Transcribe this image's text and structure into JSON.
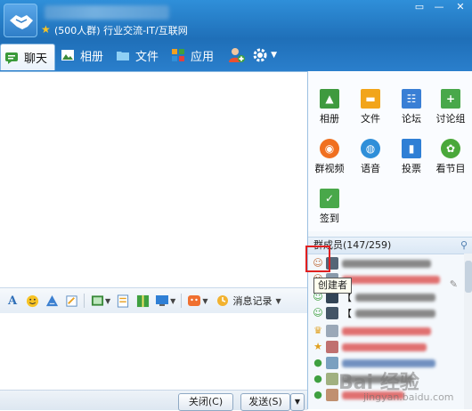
{
  "header": {
    "group_info": "(500人群) 行业交流-IT/互联网",
    "window_controls": [
      "▭",
      "—",
      "✕"
    ]
  },
  "tabs": [
    {
      "label": "聊天",
      "icon": "chat-icon",
      "active": true
    },
    {
      "label": "相册",
      "icon": "album-icon",
      "active": false
    },
    {
      "label": "文件",
      "icon": "folder-icon",
      "active": false
    },
    {
      "label": "应用",
      "icon": "apps-grid-icon",
      "active": false
    }
  ],
  "apps": [
    {
      "label": "相册",
      "icon": "album-icon",
      "color": "#3f9a3f"
    },
    {
      "label": "文件",
      "icon": "folder-icon",
      "color": "#f2a51a"
    },
    {
      "label": "论坛",
      "icon": "forum-icon",
      "color": "#3a7fd5"
    },
    {
      "label": "讨论组",
      "icon": "discussion-icon",
      "color": "#49a84a"
    },
    {
      "label": "群视频",
      "icon": "video-icon",
      "color": "#f07020"
    },
    {
      "label": "语音",
      "icon": "voice-icon",
      "color": "#2f8fd9"
    },
    {
      "label": "投票",
      "icon": "vote-icon",
      "color": "#2f7fd5"
    },
    {
      "label": "看节目",
      "icon": "show-icon",
      "color": "#4aa83a"
    },
    {
      "label": "签到",
      "icon": "checkin-icon",
      "color": "#49a84a"
    }
  ],
  "members": {
    "title": "群成员(147/259)",
    "tooltip": "创建者",
    "visible_names": [
      "【",
      "【"
    ]
  },
  "toolbar": {
    "message_record": "消息记录"
  },
  "buttons": {
    "close": "关闭(C)",
    "send": "发送(S)"
  },
  "watermark": {
    "text": "Bai 经验",
    "url": "jingyan.baidu.com"
  }
}
